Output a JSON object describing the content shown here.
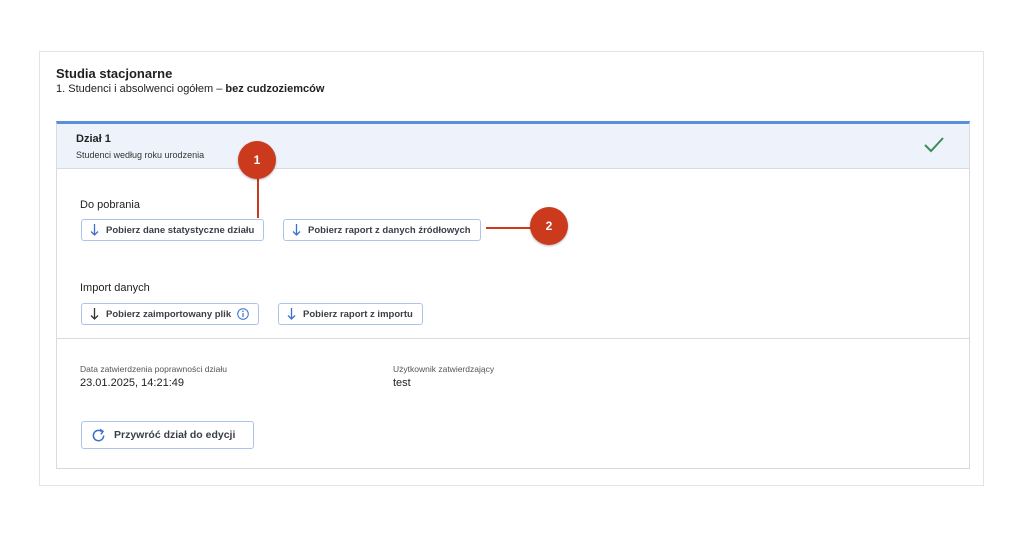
{
  "header": {
    "title": "Studia stacjonarne",
    "subtitle_prefix": "1. Studenci i absolwenci ogółem – ",
    "subtitle_bold": "bez cudzoziemców"
  },
  "section": {
    "title": "Dział 1",
    "subtitle": "Studenci według roku urodzenia",
    "status_icon": "check-icon",
    "accent_color": "#5a8fe0",
    "check_color": "#3d8c5a"
  },
  "downloads": {
    "label": "Do pobrania",
    "btn_stats": "Pobierz dane statystyczne działu",
    "btn_source_report": "Pobierz raport z danych źródłowych"
  },
  "import": {
    "label": "Import danych",
    "btn_imported_file": "Pobierz zaimportowany plik",
    "btn_import_report": "Pobierz raport z importu"
  },
  "approval": {
    "date_label": "Data zatwierdzenia poprawności działu",
    "date_value": "23.01.2025, 14:21:49",
    "user_label": "Użytkownik zatwierdzający",
    "user_value": "test"
  },
  "restore_button": "Przywróć dział do edycji",
  "callouts": [
    "1",
    "2"
  ],
  "callout_color": "#cc3a1e"
}
